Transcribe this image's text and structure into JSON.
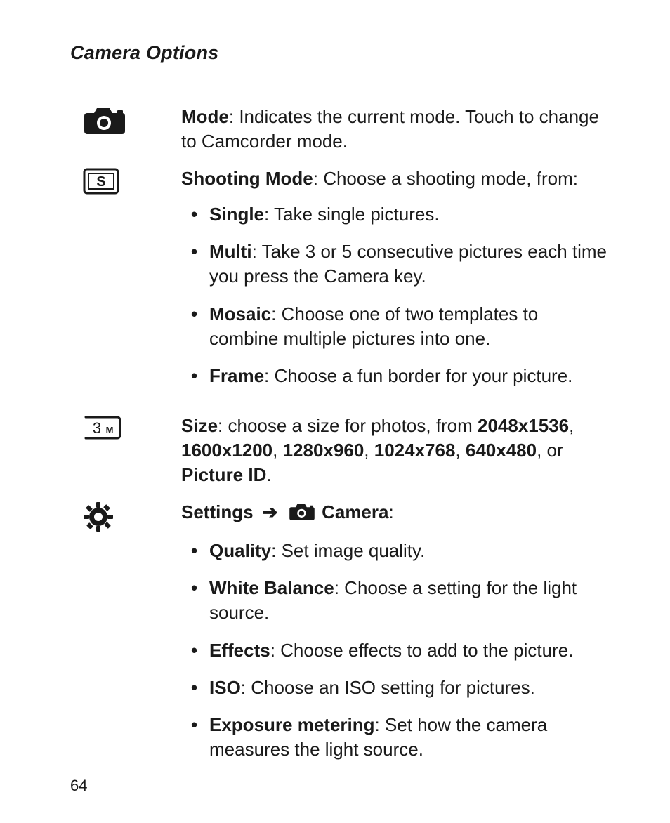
{
  "page": {
    "number": 64,
    "heading": "Camera Options"
  },
  "options": [
    {
      "icon": "camera",
      "lead": "Mode",
      "desc": ": Indicates the current mode. Touch to change to Camcorder mode."
    },
    {
      "icon": "shooting-mode",
      "lead": "Shooting Mode",
      "desc": ": Choose a shooting mode, from:",
      "bullets": [
        {
          "lead": "Single",
          "rest": ": Take single pictures."
        },
        {
          "lead": "Multi",
          "rest": ": Take 3 or 5 consecutive pictures each time you press the Camera key."
        },
        {
          "lead": "Mosaic",
          "rest": ": Choose one of two templates to combine multiple pictures into one."
        },
        {
          "lead": "Frame",
          "rest": ": Choose a fun border for your picture."
        }
      ]
    },
    {
      "icon": "size-3m",
      "lead": "Size",
      "desc": ": choose a size for photos, from ",
      "sizes": [
        "2048x1536",
        "1600x1200",
        "1280x960",
        "1024x768",
        "640x480"
      ],
      "size_joiner": ", ",
      "size_or": ", or ",
      "size_last": "Picture ID",
      "size_tail": "."
    },
    {
      "icon": "gear",
      "settings": {
        "settings_label": "Settings",
        "arrow": "➔",
        "camera_label": "Camera",
        "tail": ":"
      },
      "bullets": [
        {
          "lead": "Quality",
          "rest": ": Set image quality."
        },
        {
          "lead": "White Balance",
          "rest": ": Choose a setting for the light source."
        },
        {
          "lead": "Effects",
          "rest": ": Choose effects to add to the picture."
        },
        {
          "lead": "ISO",
          "rest": ": Choose an ISO setting for pictures."
        },
        {
          "lead": "Exposure metering",
          "rest": ": Set how the camera measures the light source."
        }
      ]
    }
  ]
}
